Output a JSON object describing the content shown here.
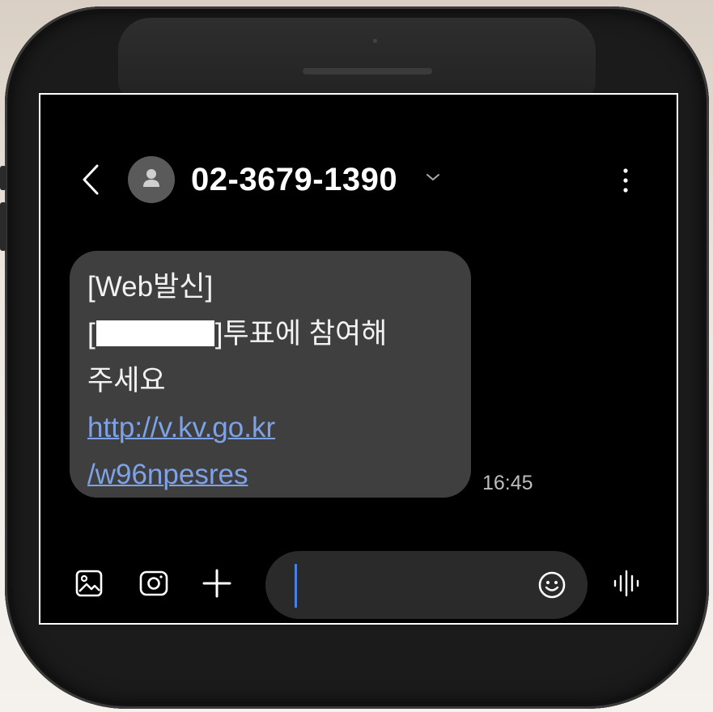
{
  "header": {
    "contact": "02-3679-1390"
  },
  "message": {
    "line1": "[Web발신]",
    "line2_prefix": "[",
    "line2_suffix": "]투표에 참여해",
    "line3": "주세요",
    "link_line1": "http://v.kv.go.kr",
    "link_line2": "/w96npesres",
    "time": "16:45"
  },
  "composer": {
    "placeholder": ""
  },
  "icons": {
    "back": "back-icon",
    "avatar": "person-icon",
    "chevron": "chevron-down-icon",
    "menu": "more-vertical-icon",
    "gallery": "gallery-icon",
    "camera": "camera-icon",
    "add": "plus-icon",
    "emoji": "emoji-icon",
    "voice": "voice-wave-icon"
  },
  "colors": {
    "screen_bg": "#000000",
    "bubble_bg": "#3f3f3f",
    "link": "#7ea2e6",
    "cursor": "#4d7fe0"
  }
}
